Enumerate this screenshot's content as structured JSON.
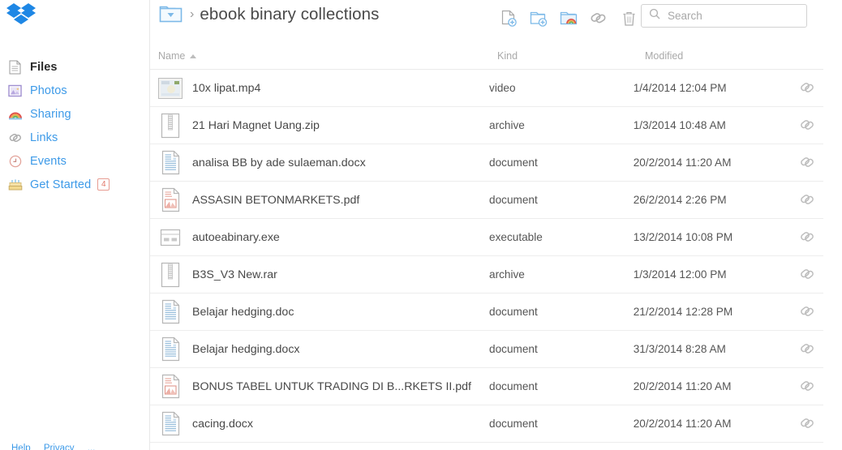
{
  "brand": {
    "logo": "dropbox-logo",
    "color": "#1e87e5"
  },
  "sidebar": {
    "items": [
      {
        "label": "Files",
        "icon": "file-icon",
        "active": true,
        "badge": null
      },
      {
        "label": "Photos",
        "icon": "photo-icon",
        "active": false,
        "badge": null
      },
      {
        "label": "Sharing",
        "icon": "rainbow-icon",
        "active": false,
        "badge": null
      },
      {
        "label": "Links",
        "icon": "link-icon",
        "active": false,
        "badge": null
      },
      {
        "label": "Events",
        "icon": "clock-icon",
        "active": false,
        "badge": null
      },
      {
        "label": "Get Started",
        "icon": "cake-icon",
        "active": false,
        "badge": "4"
      }
    ],
    "footer": [
      "Help",
      "Privacy",
      "..."
    ]
  },
  "header": {
    "breadcrumb": {
      "folder_icon": "folder-dropdown-icon",
      "separator": "›",
      "title": "ebook binary collections"
    },
    "toolbar": [
      {
        "name": "upload-file-button",
        "icon": "file-plus-icon",
        "label": "Upload file"
      },
      {
        "name": "new-folder-button",
        "icon": "folder-plus-icon",
        "label": "New folder"
      },
      {
        "name": "share-folder-button",
        "icon": "shared-folder-icon",
        "label": "Share folder"
      },
      {
        "name": "get-link-button",
        "icon": "paperclip-icon",
        "label": "Get link"
      },
      {
        "name": "delete-button",
        "icon": "trash-icon",
        "label": "Delete"
      }
    ],
    "search": {
      "placeholder": "Search",
      "value": "",
      "icon": "search-icon"
    }
  },
  "table": {
    "columns": {
      "name": "Name",
      "kind": "Kind",
      "modified": "Modified"
    },
    "sort": {
      "column": "Name",
      "direction": "asc"
    },
    "rows": [
      {
        "name": "10x lipat.mp4",
        "kind": "video",
        "modified": "1/4/2014 12:04 PM",
        "icon": "video-thumbnail"
      },
      {
        "name": "21 Hari Magnet Uang.zip",
        "kind": "archive",
        "modified": "1/3/2014 10:48 AM",
        "icon": "archive-icon"
      },
      {
        "name": "analisa BB by ade sulaeman.docx",
        "kind": "document",
        "modified": "20/2/2014 11:20 AM",
        "icon": "document-icon"
      },
      {
        "name": "ASSASIN BETONMARKETS.pdf",
        "kind": "document",
        "modified": "26/2/2014 2:26 PM",
        "icon": "pdf-icon"
      },
      {
        "name": "autoeabinary.exe",
        "kind": "executable",
        "modified": "13/2/2014 10:08 PM",
        "icon": "executable-icon"
      },
      {
        "name": "B3S_V3 New.rar",
        "kind": "archive",
        "modified": "1/3/2014 12:00 PM",
        "icon": "archive-icon"
      },
      {
        "name": "Belajar hedging.doc",
        "kind": "document",
        "modified": "21/2/2014 12:28 PM",
        "icon": "document-icon"
      },
      {
        "name": "Belajar hedging.docx",
        "kind": "document",
        "modified": "31/3/2014 8:28 AM",
        "icon": "document-icon"
      },
      {
        "name": "BONUS TABEL UNTUK TRADING DI B...RKETS II.pdf",
        "kind": "document",
        "modified": "20/2/2014 11:20 AM",
        "icon": "pdf-icon"
      },
      {
        "name": "cacing.docx",
        "kind": "document",
        "modified": "20/2/2014 11:20 AM",
        "icon": "document-icon"
      }
    ],
    "row_action_icon": "paperclip-icon"
  }
}
